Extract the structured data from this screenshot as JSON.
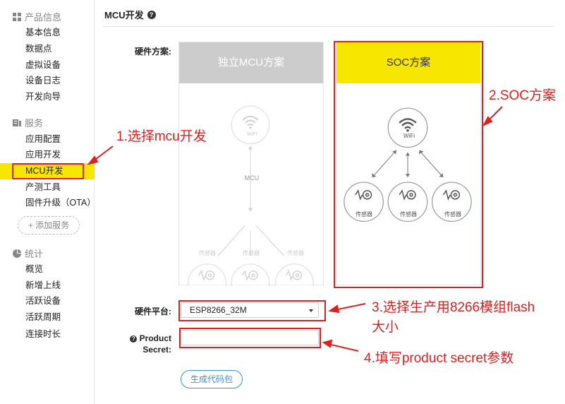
{
  "sidebar": {
    "sections": [
      {
        "title": "产品信息",
        "icon": "grid-icon",
        "items": [
          "基本信息",
          "数据点",
          "虚拟设备",
          "设备日志",
          "开发向导"
        ]
      },
      {
        "title": "服务",
        "icon": "service-icon",
        "items": [
          "应用配置",
          "应用开发",
          "MCU开发",
          "产测工具",
          "固件升级（OTA）"
        ]
      },
      {
        "title": "统计",
        "icon": "pie-icon",
        "items": [
          "概览",
          "新增上线",
          "活跃设备",
          "活跃周期",
          "连接时长"
        ]
      }
    ],
    "active_item": "MCU开发",
    "add_service": "+ 添加服务"
  },
  "main": {
    "title": "MCU开发",
    "hardware_scheme_label": "硬件方案:",
    "schemes": [
      {
        "title": "独立MCU方案",
        "selected": false,
        "mcu_label": "MCU",
        "wifi_label": "WiFi",
        "sensor_label": "传感器"
      },
      {
        "title": "SOC方案",
        "selected": true,
        "wifi_label": "WiFi",
        "sensor_label": "传感器"
      }
    ],
    "platform_label": "硬件平台:",
    "platform_value": "ESP8266_32M",
    "secret_label_1": "Product",
    "secret_label_2": "Secret:",
    "secret_value": "",
    "generate_button": "生成代码包"
  },
  "annotations": {
    "a1": "1.选择mcu开发",
    "a2": "2.SOC方案",
    "a3_line1": "3.选择生产用8266模组flash",
    "a3_line2": "大小",
    "a4": "4.填写product secret参数"
  },
  "colors": {
    "highlight": "#f6e600",
    "annotation": "#e02020",
    "accent": "#3c8dde",
    "disabled": "#cccccc"
  }
}
